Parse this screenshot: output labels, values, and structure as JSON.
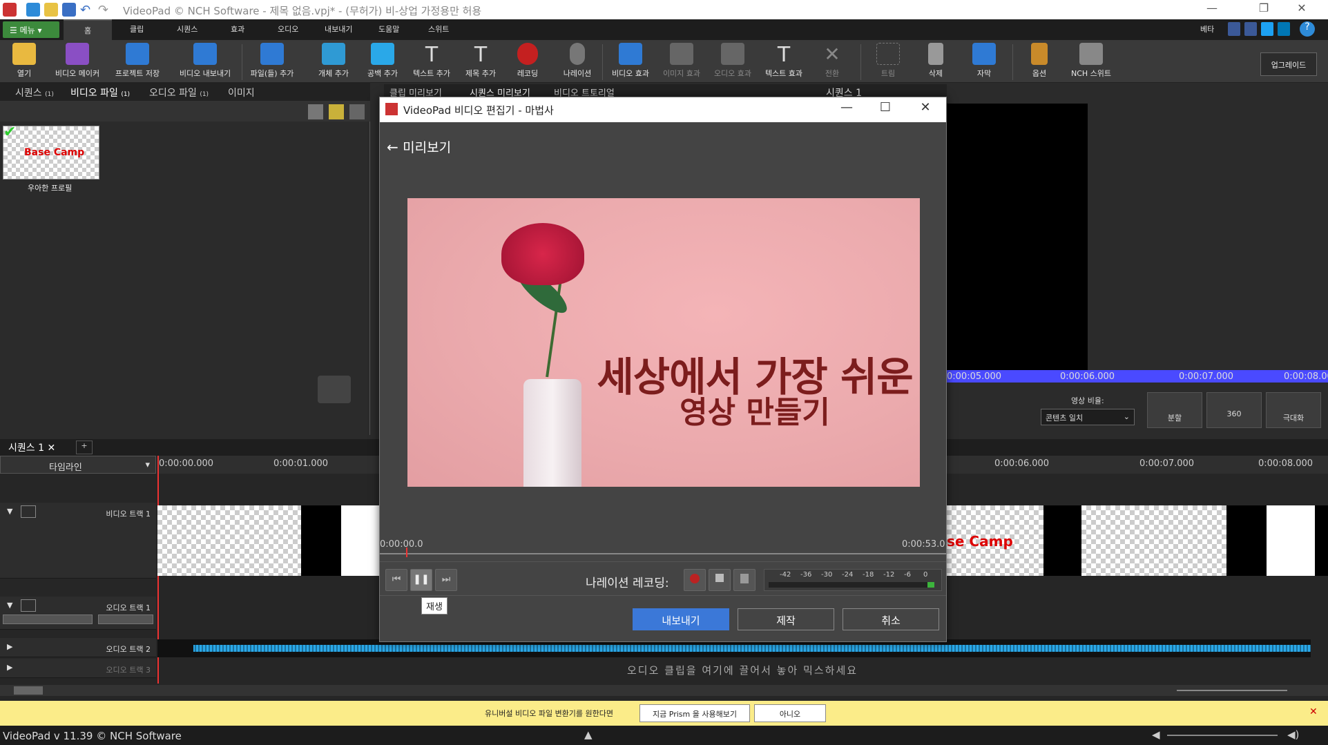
{
  "titlebar": {
    "title": "VideoPad © NCH Software - 제목 없음.vpj* - (무허가) 비-상업 가정용만 허용"
  },
  "tabs": {
    "menu": "메뉴",
    "items": [
      "홈",
      "클립",
      "시퀀스",
      "효과",
      "오디오",
      "내보내기",
      "도움말",
      "스위트"
    ],
    "beta": "베타"
  },
  "toolbar": {
    "items": [
      "열기",
      "비디오 메이커",
      "프로젝트 저장",
      "비디오 내보내기",
      "파일(들) 추가",
      "개체 추가",
      "공백 추가",
      "텍스트 추가",
      "제목 추가",
      "레코딩",
      "나레이션",
      "비디오 효과",
      "이미지 효과",
      "오디오 효과",
      "텍스트 효과",
      "전환",
      "트림",
      "삭제",
      "자막",
      "옵션",
      "NCH 스위트"
    ],
    "upgrade": "업그레이드"
  },
  "bin": {
    "tabs": [
      {
        "label": "시퀀스",
        "count": "(1)"
      },
      {
        "label": "비디오 파일",
        "count": "(1)"
      },
      {
        "label": "오디오 파일",
        "count": "(1)"
      },
      {
        "label": "이미지",
        "count": ""
      }
    ],
    "clip": {
      "thumb_text": "Base Camp",
      "label": "우아한 프로필"
    }
  },
  "preview_tabs": [
    "클립 미리보기",
    "시퀀스 미리보기",
    "비디오 트토리얼"
  ],
  "sequence_title": "시퀀스 1",
  "preview_right": {
    "times": [
      "0:00:05.000",
      "0:00:06.000",
      "0:00:07.000",
      "0:00:08.000"
    ],
    "aspect_label": "영상 비율:",
    "aspect_value": "콘텐츠 일치",
    "split": "분할",
    "b360": "360",
    "fullscreen": "극대화"
  },
  "timeline": {
    "seq_tab": "시퀀스 1",
    "mode": "타임라인",
    "ruler": [
      "0:00:00.000",
      "0:00:01.000",
      "0:00:06.000",
      "0:00:07.000",
      "0:00:08.000"
    ],
    "tracks": [
      "비디오 트랙 1",
      "오디오 트랙 1",
      "오디오 트랙 2",
      "오디오 트랙 3"
    ],
    "audio_hint": "오디오 클립을 여기에 끌어서 놓아 믹스하세요",
    "clip_text": "se Camp"
  },
  "notify": {
    "text": "유니버설 비디오 파일 변환기를 원한다면",
    "try_btn": "지금 Prism 을 사용해보기",
    "no_btn": "아니오"
  },
  "status": {
    "version": "VideoPad v 11.39 © NCH Software"
  },
  "dialog": {
    "title": "VideoPad 비디오 편집기 - 마법사",
    "heading": "미리보기",
    "caption_line1": "세상에서 가장 쉬운",
    "caption_line2": "영상 만들기",
    "time_start": "0:00:00.0",
    "time_end": "0:00:53.0",
    "narration_label": "나레이션 레코딩:",
    "meter_ticks": [
      "-42",
      "-36",
      "-30",
      "-24",
      "-18",
      "-12",
      "-6",
      "0"
    ],
    "tooltip": "재생",
    "export": "내보내기",
    "make": "제작",
    "cancel": "취소"
  },
  "colors": {
    "accent_blue": "#3b78d8",
    "green": "#3c8a3c",
    "notify_bg": "#fbec89",
    "track_blue": "#4a4aff"
  }
}
